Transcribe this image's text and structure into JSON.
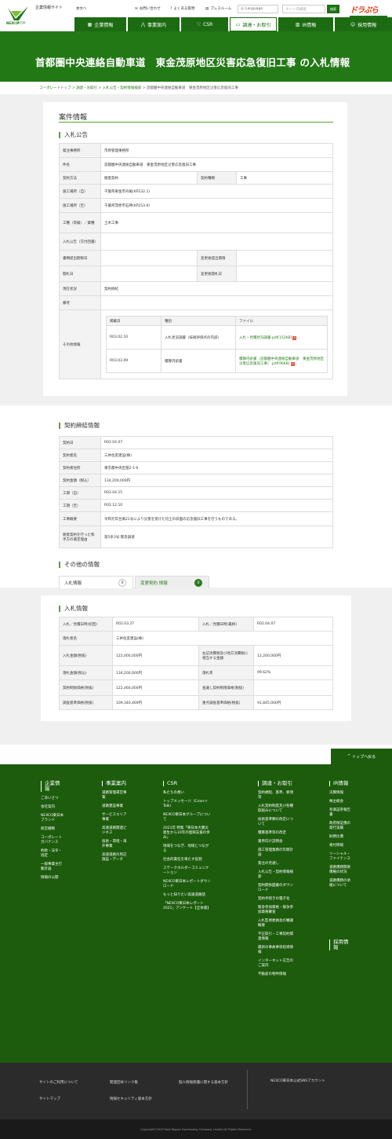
{
  "header": {
    "logo": "NEXCO",
    "logo_sub": "東日本",
    "corp_link": "企業情報サイト",
    "home_link": "本文へ",
    "util": [
      "お問い合わせ",
      "よくある質問",
      "プレスルーム"
    ],
    "language": "Language",
    "search_placeholder": "サイト内検索",
    "search_button": "検索",
    "brand": "ドラぷら"
  },
  "nav": [
    {
      "label": "企業情報",
      "icon": "building-icon"
    },
    {
      "label": "事業案内",
      "icon": "road-icon"
    },
    {
      "label": "CSR",
      "icon": "heart-icon"
    },
    {
      "label": "調達・お取引",
      "icon": "handshake-icon"
    },
    {
      "label": "IR情報",
      "icon": "chart-icon"
    },
    {
      "label": "採用情報",
      "icon": "people-icon"
    }
  ],
  "hero": {
    "title": "首都圏中央連絡自動車道　東金茂原地区災害応急復旧工事 の入札情報"
  },
  "breadcrumb": [
    "コーポレートトップ",
    "調達・お取引",
    "入札公告・契約情報検索",
    "首都圏中央連絡自動車道　東金茂原地区災害応急復旧工事"
  ],
  "case": {
    "title": "案件情報",
    "section": "入札公告",
    "rows": [
      {
        "label": "発注事務所",
        "value": "市原管理事務所"
      },
      {
        "label": "件名",
        "value": "首都圏中央連絡自動車道　東金茂原地区災害応急復旧工事"
      },
      {
        "label": "契約方法",
        "value": "随意契約",
        "label2": "契約種類",
        "value2": "工事"
      },
      {
        "label": "施工場所（自）",
        "value": "千葉県東金市丹尾(KP232.1)"
      },
      {
        "label": "施工場所（至）",
        "value": "千葉県茂原市石神(KP253.9)"
      },
      {
        "label": "工種（等級）／業種",
        "value": "土木工事"
      },
      {
        "label": "入札公告（交付回書）",
        "value": ""
      },
      {
        "label": "書類提出期限日",
        "value": "",
        "label2": "変更後提出期限",
        "value2": ""
      },
      {
        "label": "開札日",
        "value": "",
        "label2": "変更後開札日",
        "value2": ""
      },
      {
        "label": "現在状況",
        "value": "契約締結"
      },
      {
        "label": "備考",
        "value": ""
      }
    ],
    "other_label": "その他情報",
    "files_head": [
      "掲載日",
      "種別",
      "ファイル"
    ],
    "files": [
      {
        "date": "R03.02.10",
        "type": "入札状況調書（技術評価点の内訳）",
        "file": "入札・見積状況調書.pdf[152KB]"
      },
      {
        "date": "R03.03.09",
        "type": "積算内訳書",
        "file": "積算内訳書（首都圏中央連絡自動車道　東金茂原地区災害応急復旧工事）.pdf[96KB]"
      }
    ]
  },
  "contract": {
    "title": "契約締結情報",
    "rows": [
      {
        "label": "契約日",
        "value": "R02.04.07"
      },
      {
        "label": "契約者名",
        "value": "三井住友建設(株)"
      },
      {
        "label": "契約者住所",
        "value": "東京都中央区佃2-1-6"
      },
      {
        "label": "契約金額（税込）",
        "value": "134,200,000円"
      },
      {
        "label": "工期（自）",
        "value": "R02.04.15"
      },
      {
        "label": "工期（至）",
        "value": "R02.12.10"
      },
      {
        "label": "工事概要",
        "value": "令和元年台風21号により災害を受けた切土の斜面の応急復旧工事を行うものである。"
      },
      {
        "label": "随意契約を行った和手方の選定理由",
        "value": "第5条3号:緊急調達"
      }
    ]
  },
  "other": {
    "title": "その他の情報",
    "tabs": [
      {
        "label": "入札情報",
        "count": "0"
      },
      {
        "label": "変更契約 情報",
        "count": "0"
      }
    ]
  },
  "bid": {
    "title": "入札情報",
    "rows": [
      {
        "l1": "入札／見積日時(初回)",
        "v1": "R02.03.27",
        "l2": "入札／見積日時(最終)",
        "v2": "R02.04.07"
      },
      {
        "l1": "落札者名",
        "v1": "三井住友建設(株)"
      },
      {
        "l1": "入札金額(税抜)",
        "v1": "122,000,000円",
        "l2": "左記消費税及び地方消費税に相当する金額",
        "v2": "12,200,000円"
      },
      {
        "l1": "落札金額(税込)",
        "v1": "134,200,000円",
        "l2": "落札率",
        "v2": "99.62%"
      },
      {
        "l1": "契約制限価格(税抜)",
        "v1": "122,460,000円",
        "l2": "查違し契約制限価格(税抜)",
        "v2": ""
      },
      {
        "l1": "調査基準価格(税抜)",
        "v1": "109,340,469円",
        "l2": "重点調査基準価格(税抜)",
        "v2": "91,845,000円"
      }
    ]
  },
  "pagetop": "トップへ戻る",
  "footer": {
    "cols": [
      {
        "title": "企業情報",
        "items": [
          "ごあいさつ",
          "会社案内",
          "NEXCO東日本ブランド",
          "経営戦略",
          "コーポレートガバナンス",
          "約款・法令・協定",
          "一般事業主行動計画",
          "情報の公開"
        ]
      },
      {
        "title": "事業案内",
        "items": [
          "道路管理運営事業",
          "道路建設事業",
          "サービスエリア事業",
          "高速道路関連ビジネス",
          "技術・環境・海外事業",
          "高速道路の周辺施設・データ"
        ]
      },
      {
        "title": "CSR",
        "items": [
          "私たちの想い",
          "トップメッセージ（Cross＋Talk）",
          "NEXCO東日本グループについて",
          "2021年 特集「東日本大震災発生から10年の復興支援の歩み」",
          "地域をつなぎ、地域とつながる",
          "社会的責任を果たす役割",
          "ステークホルダーコミュニケーション",
          "NEXCO東日本レポートダウンロード",
          "もっと知りたい高速道路話",
          "「NEXCO東日本レポート2021」アンケート【全体版】"
        ]
      },
      {
        "title": "調達・お取引",
        "items": [
          "契約規程、基準、要領等",
          "入札契約制度及び各種取組みについて",
          "技術基準類の改定について",
          "積算基準等の改定",
          "業界向け説明会",
          "施工管理業務の年間計画",
          "発注の見通し",
          "入札公告・契約情報検索",
          "契約関係図書のダウンロード",
          "契約手続きの電子化",
          "競争参加資格・競争参加資格審査",
          "入札監視委員会の審議概要",
          "不正取引・工事契約関連情報",
          "最新の事故事等指導情報",
          "インターネット広告のご案内",
          "不動産の物件情報"
        ]
      },
      {
        "title": "IR情報",
        "items": [
          "決算情報",
          "株主総会",
          "有価証券報告書",
          "政府保証債の発行実績",
          "財務比債",
          "格付情報",
          "ソーシャル・ファイナンス",
          "道路債務関係債権の状況",
          "道路債務の承継について"
        ]
      },
      {
        "title": "採用情報",
        "items": []
      }
    ]
  },
  "bottom": {
    "links": [
      "サイトのご利用について",
      "関連団体リンク集",
      "個人情報保護に関する基本方針",
      "サイトマップ",
      "情報セキュリティ基本方針"
    ],
    "sns": "NEXCO東日本公式SNSアカウント",
    "copyright": "Copyright©2020 East Nippon Expressway Company Limited All Rights Reserved."
  }
}
